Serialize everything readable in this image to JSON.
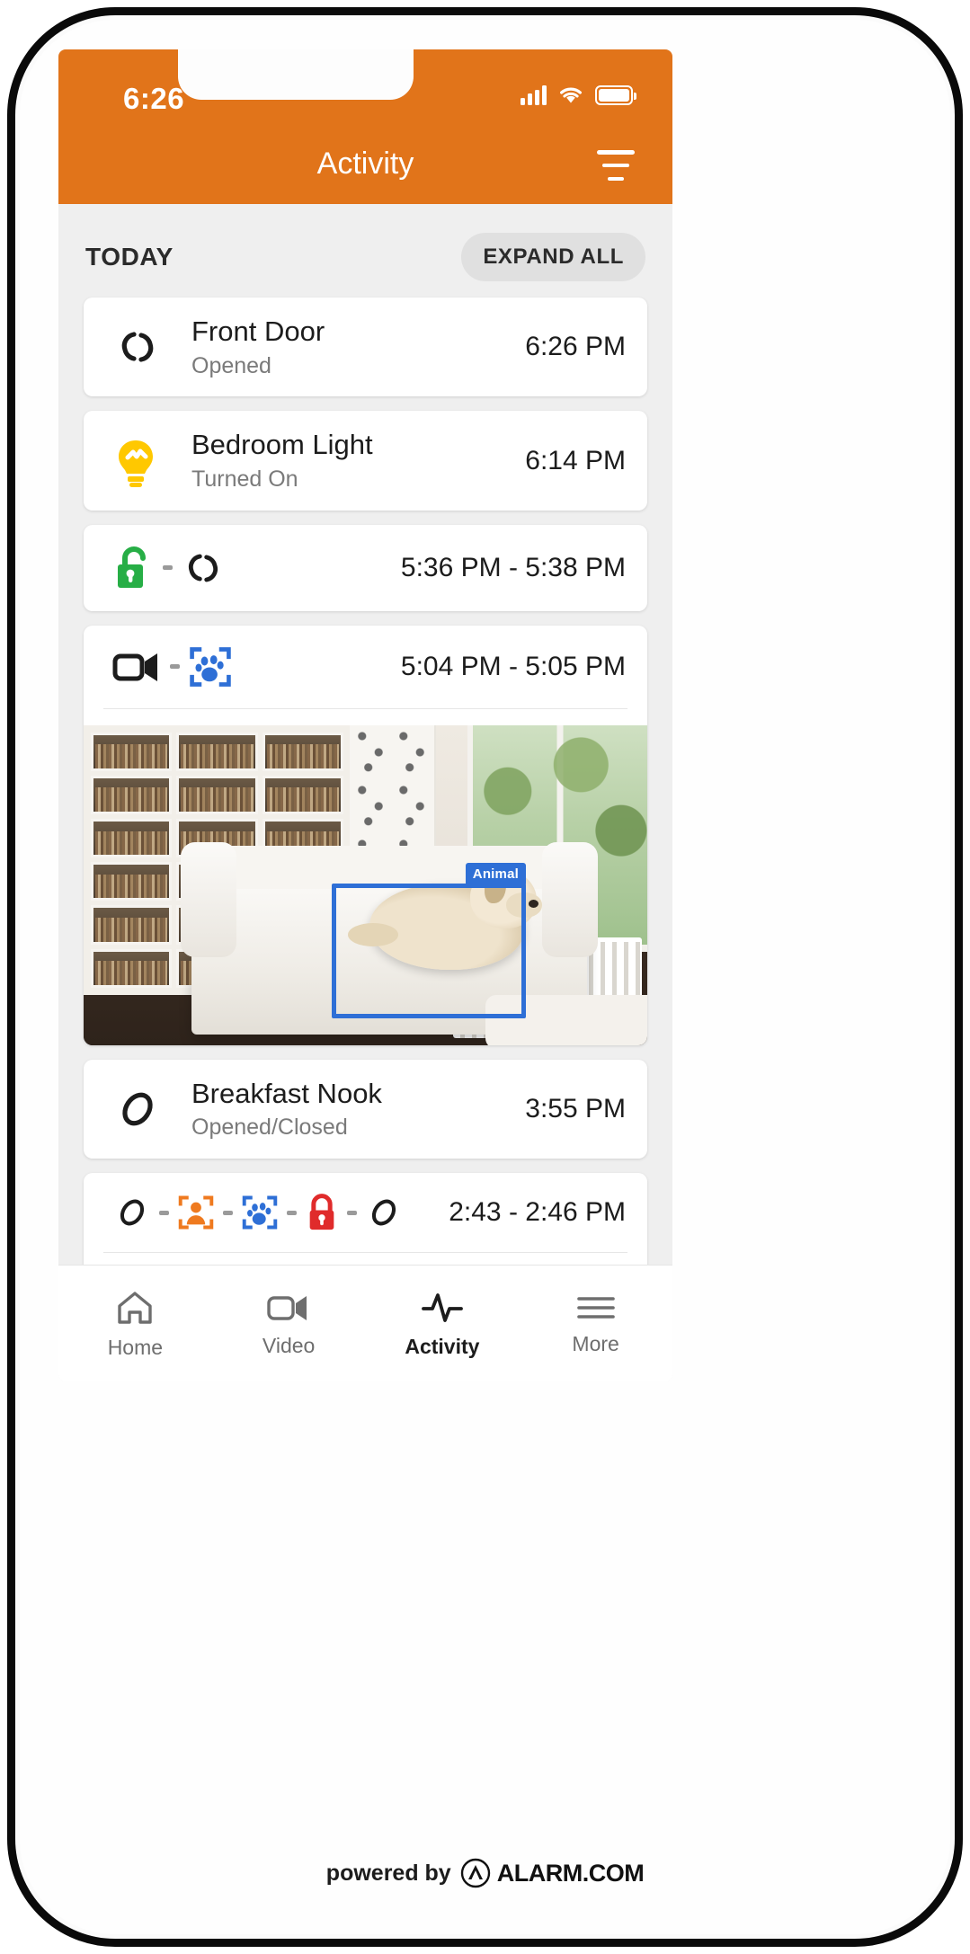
{
  "colors": {
    "brand_orange": "#e1741a",
    "screen_bg": "#efefef",
    "card_bg": "#ffffff",
    "detection_blue": "#2e6fd6",
    "unlock_green": "#27ae46",
    "lock_red": "#e02b2b",
    "bulb_yellow": "#ffc800",
    "person_orange": "#ef7a1f"
  },
  "status_bar": {
    "time": "6:26",
    "signal_icon": "cellular-signal-icon",
    "wifi_icon": "wifi-icon",
    "battery_icon": "battery-full-icon"
  },
  "header": {
    "title": "Activity",
    "filter_icon": "filter-icon"
  },
  "section": {
    "label": "TODAY",
    "expand_all_label": "EXPAND ALL"
  },
  "events": [
    {
      "id": "front-door",
      "icons": [
        "contact-sensor-open-icon"
      ],
      "name": "Front Door",
      "state": "Opened",
      "time": "6:26 PM",
      "has_media": false
    },
    {
      "id": "bedroom-light",
      "icons": [
        "lightbulb-on-icon"
      ],
      "name": "Bedroom Light",
      "state": "Turned On",
      "time": "6:14 PM",
      "has_media": false
    },
    {
      "id": "unlock-door",
      "icons": [
        "lock-open-icon",
        "contact-sensor-open-icon"
      ],
      "name": "",
      "state": "",
      "time": "5:36 PM - 5:38 PM",
      "has_media": false
    },
    {
      "id": "camera-animal",
      "icons": [
        "video-camera-icon",
        "animal-detection-icon"
      ],
      "name": "",
      "state": "",
      "time": "5:04 PM - 5:05 PM",
      "has_media": true,
      "media_type": "living-room-clip",
      "detection_label": "Animal"
    },
    {
      "id": "breakfast-nook",
      "icons": [
        "contact-sensor-closed-icon"
      ],
      "name": "Breakfast Nook",
      "state": "Opened/Closed",
      "time": "3:55 PM",
      "has_media": false
    },
    {
      "id": "multi-event",
      "icons": [
        "contact-sensor-closed-icon",
        "person-detection-icon",
        "animal-detection-icon",
        "lock-closed-icon",
        "contact-sensor-closed-icon"
      ],
      "name": "",
      "state": "",
      "time": "2:43 - 2:46 PM",
      "has_media": true,
      "media_type": "dark-clip"
    }
  ],
  "tabbar": {
    "items": [
      {
        "id": "home",
        "icon": "home-icon",
        "label": "Home",
        "active": false
      },
      {
        "id": "video",
        "icon": "video-icon",
        "label": "Video",
        "active": false
      },
      {
        "id": "activity",
        "icon": "activity-icon",
        "label": "Activity",
        "active": true
      },
      {
        "id": "more",
        "icon": "menu-icon",
        "label": "More",
        "active": false
      }
    ]
  },
  "footer": {
    "powered_by": "powered by",
    "brand": "ALARM.COM",
    "brand_mark": "alarm-com-logo-icon"
  }
}
